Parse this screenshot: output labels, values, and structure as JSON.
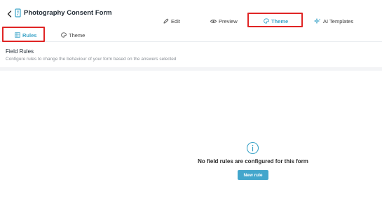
{
  "header": {
    "title": "Photography Consent Form",
    "tabs": {
      "edit": "Edit",
      "preview": "Preview",
      "theme": "Theme",
      "ai_templates": "AI Templates"
    },
    "active_tab": "theme"
  },
  "subnav": {
    "rules": "Rules",
    "theme": "Theme",
    "active": "rules"
  },
  "field_rules": {
    "title": "Field Rules",
    "description": "Configure rules to change the behaviour of your form based on the answers selected"
  },
  "empty_state": {
    "message": "No field rules are configured for this form",
    "button_label": "New rule"
  },
  "colors": {
    "accent": "#3aa3c7",
    "button": "#43a6cc",
    "highlight_box": "#e02424"
  },
  "icons": [
    "chevron-left-icon",
    "form-icon",
    "pencil-icon",
    "eye-icon",
    "palette-icon",
    "sparkle-icon",
    "table-icon",
    "info-icon"
  ]
}
